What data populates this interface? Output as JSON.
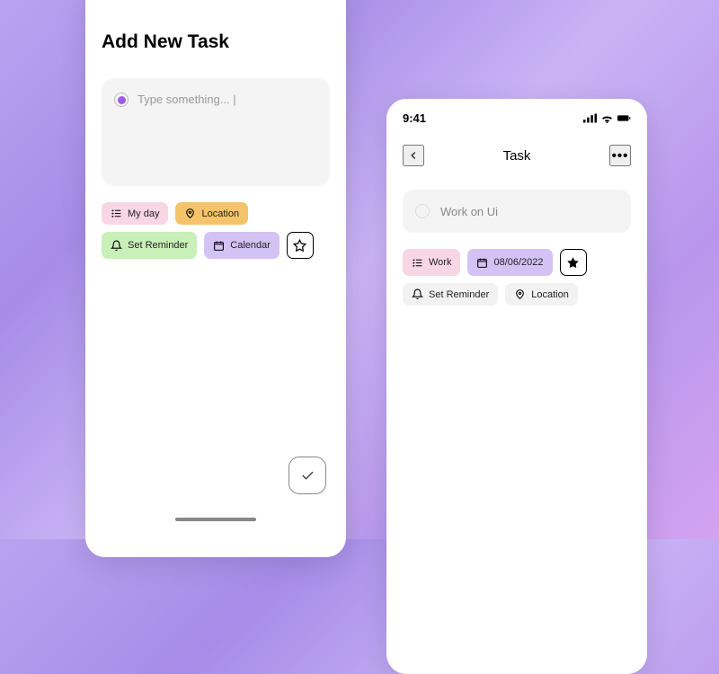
{
  "leftPhone": {
    "title": "Add New Task",
    "input": {
      "placeholder": "Type something... |"
    },
    "chips": {
      "myDay": "My day",
      "location": "Location",
      "reminder": "Set Reminder",
      "calendar": "Calendar"
    }
  },
  "rightPhone": {
    "statusTime": "9:41",
    "navTitle": "Task",
    "taskText": "Work on Ui",
    "chips": {
      "work": "Work",
      "date": "08/06/2022",
      "reminder": "Set Reminder",
      "location": "Location"
    }
  }
}
